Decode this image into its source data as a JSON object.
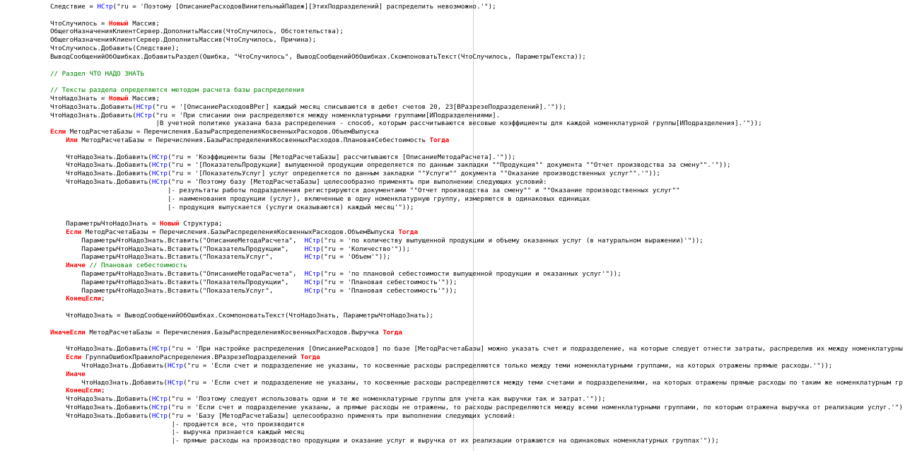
{
  "code": {
    "lines": [
      [
        {
          "t": "plain",
          "v": "Следствие = "
        },
        {
          "t": "fn",
          "v": "НСтр"
        },
        {
          "t": "plain",
          "v": "(\"ru = '"
        },
        {
          "t": "str",
          "v": "Поэтому [ОписаниеРасходовВинительныйПадеж][ЭтихПодразделений] распределить невозможно.'"
        },
        {
          "t": "plain",
          "v": "\");"
        }
      ],
      [],
      [
        {
          "t": "plain",
          "v": "ЧтоСлучилось = "
        },
        {
          "t": "kw",
          "v": "Новый"
        },
        {
          "t": "plain",
          "v": " Массив;"
        }
      ],
      [
        {
          "t": "plain",
          "v": "ОбщегоНазначенияКлиентСервер.ДополнитьМассив(ЧтоСлучилось, Обстоятельства);"
        }
      ],
      [
        {
          "t": "plain",
          "v": "ОбщегоНазначенияКлиентСервер.ДополнитьМассив(ЧтоСлучилось, Причина);"
        }
      ],
      [
        {
          "t": "plain",
          "v": "ЧтоСлучилось.Добавить(Следствие);"
        }
      ],
      [
        {
          "t": "plain",
          "v": "ВыводСообщенийОбОшибках.ДобавитьРаздел(Ошибка, "
        },
        {
          "t": "str",
          "v": "\"ЧтоСлучилось\""
        },
        {
          "t": "plain",
          "v": ", ВыводСообщенийОбОшибках.СкомпоноватьТекст(ЧтоСлучилось, ПараметрыТекста));"
        }
      ],
      [],
      [
        {
          "t": "cm",
          "v": "// Раздел ЧТО НАДО ЗНАТЬ"
        }
      ],
      [],
      [
        {
          "t": "cm",
          "v": "// Тексты раздела определяются методом расчета базы распределения"
        }
      ],
      [
        {
          "t": "plain",
          "v": "ЧтоНадоЗнать = "
        },
        {
          "t": "kw",
          "v": "Новый"
        },
        {
          "t": "plain",
          "v": " Массив;"
        }
      ],
      [
        {
          "t": "plain",
          "v": "ЧтоНадоЗнать.Добавить("
        },
        {
          "t": "fn",
          "v": "НСтр"
        },
        {
          "t": "plain",
          "v": "(\"ru = '"
        },
        {
          "t": "str",
          "v": "[ОписаниеРасходовВРег] каждый месяц списываются в дебет счетов 20, 23[ВРазрезеПодразделений]."
        },
        {
          "t": "plain",
          "v": "'\"));"
        }
      ],
      [
        {
          "t": "plain",
          "v": "ЧтоНадоЗнать.Добавить("
        },
        {
          "t": "fn",
          "v": "НСтр"
        },
        {
          "t": "plain",
          "v": "(\"ru = '"
        },
        {
          "t": "str",
          "v": "При списании они распределяются между номенклатурными группами[ИПодразделениями]."
        }
      ],
      [
        {
          "t": "plain",
          "v": "                           "
        },
        {
          "t": "str",
          "v": "|В учетной политике указана база распределения - способ, которым рассчитываются весовые коэффициенты для каждой номенклатурной группы[ИПодразделения]."
        },
        {
          "t": "plain",
          "v": "'\"));"
        }
      ],
      [
        {
          "t": "kw",
          "v": "Если"
        },
        {
          "t": "plain",
          "v": " МетодРасчетаБазы = Перечисления.БазыРаспределенияКосвенныхРасходов.ОбъемВыпуска"
        }
      ],
      [
        {
          "t": "plain",
          "v": "    "
        },
        {
          "t": "kw",
          "v": "Или"
        },
        {
          "t": "plain",
          "v": " МетодРасчетаБазы = Перечисления.БазыРаспределенияКосвенныхРасходов.ПлановаяСебестоимость "
        },
        {
          "t": "kw",
          "v": "Тогда"
        }
      ],
      [],
      [
        {
          "t": "plain",
          "v": "    ЧтоНадоЗнать.Добавить("
        },
        {
          "t": "fn",
          "v": "НСтр"
        },
        {
          "t": "plain",
          "v": "(\"ru = '"
        },
        {
          "t": "str",
          "v": "Коэффициенты базы [МетодРасчетаБазы] рассчитываются [ОписаниеМетодаРасчета]."
        },
        {
          "t": "plain",
          "v": "'\"));"
        }
      ],
      [
        {
          "t": "plain",
          "v": "    ЧтоНадоЗнать.Добавить("
        },
        {
          "t": "fn",
          "v": "НСтр"
        },
        {
          "t": "plain",
          "v": "(\"ru = '"
        },
        {
          "t": "str",
          "v": "[ПоказательПродукции] выпущенной продукции определяется по данным закладки \"\"Продукция\"\" документа \"\"Отчет производства за смену\"\"."
        },
        {
          "t": "plain",
          "v": "'\"));"
        }
      ],
      [
        {
          "t": "plain",
          "v": "    ЧтоНадоЗнать.Добавить("
        },
        {
          "t": "fn",
          "v": "НСтр"
        },
        {
          "t": "plain",
          "v": "(\"ru = '"
        },
        {
          "t": "str",
          "v": "[ПоказательУслуг] услуг определяется по данным закладки \"\"Услуги\"\" документа \"\"Оказание производственных услуг\"\"."
        },
        {
          "t": "plain",
          "v": "'\"));"
        }
      ],
      [
        {
          "t": "plain",
          "v": "    ЧтоНадоЗнать.Добавить("
        },
        {
          "t": "fn",
          "v": "НСтр"
        },
        {
          "t": "plain",
          "v": "(\"ru = '"
        },
        {
          "t": "str",
          "v": "Поэтому базу [МетодРасчетаБазы] целесообразно применять при выполнении следующих условий:"
        }
      ],
      [
        {
          "t": "plain",
          "v": "                              "
        },
        {
          "t": "str",
          "v": "|- результаты работы подразделения регистрируются документами \"\"Отчет производства за смену\"\" и \"\"Оказание производственных услуг\"\""
        }
      ],
      [
        {
          "t": "plain",
          "v": "                              "
        },
        {
          "t": "str",
          "v": "|- наименования продукции (услуг), включенные в одну номенклатурную группу, измеряются в одинаковых единицах"
        }
      ],
      [
        {
          "t": "plain",
          "v": "                              "
        },
        {
          "t": "str",
          "v": "|- продукция выпускается (услуги оказываются) каждый месяц"
        },
        {
          "t": "plain",
          "v": "'\"));"
        }
      ],
      [],
      [
        {
          "t": "plain",
          "v": "    ПараметрыЧтоНадоЗнать = "
        },
        {
          "t": "kw",
          "v": "Новый"
        },
        {
          "t": "plain",
          "v": " Структура;"
        }
      ],
      [
        {
          "t": "plain",
          "v": "    "
        },
        {
          "t": "kw",
          "v": "Если"
        },
        {
          "t": "plain",
          "v": " МетодРасчетаБазы = Перечисления.БазыРаспределенияКосвенныхРасходов.ОбъемВыпуска "
        },
        {
          "t": "kw",
          "v": "Тогда"
        }
      ],
      [
        {
          "t": "plain",
          "v": "        ПараметрыЧтоНадоЗнать.Вставить("
        },
        {
          "t": "str",
          "v": "\"ОписаниеМетодаРасчета\""
        },
        {
          "t": "plain",
          "v": ",  "
        },
        {
          "t": "fn",
          "v": "НСтр"
        },
        {
          "t": "plain",
          "v": "(\"ru = '"
        },
        {
          "t": "str",
          "v": "по количеству выпущенной продукции и объему оказанных услуг (в натуральном выражении)"
        },
        {
          "t": "plain",
          "v": "'\"));"
        }
      ],
      [
        {
          "t": "plain",
          "v": "        ПараметрыЧтоНадоЗнать.Вставить("
        },
        {
          "t": "str",
          "v": "\"ПоказательПродукции\""
        },
        {
          "t": "plain",
          "v": ",    "
        },
        {
          "t": "fn",
          "v": "НСтр"
        },
        {
          "t": "plain",
          "v": "(\"ru = '"
        },
        {
          "t": "str",
          "v": "Количество"
        },
        {
          "t": "plain",
          "v": "'\"));"
        }
      ],
      [
        {
          "t": "plain",
          "v": "        ПараметрыЧтоНадоЗнать.Вставить("
        },
        {
          "t": "str",
          "v": "\"ПоказательУслуг\""
        },
        {
          "t": "plain",
          "v": ",        "
        },
        {
          "t": "fn",
          "v": "НСтр"
        },
        {
          "t": "plain",
          "v": "(\"ru = '"
        },
        {
          "t": "str",
          "v": "Объем"
        },
        {
          "t": "plain",
          "v": "'\"));"
        }
      ],
      [
        {
          "t": "plain",
          "v": "    "
        },
        {
          "t": "kw",
          "v": "Иначе"
        },
        {
          "t": "plain",
          "v": " "
        },
        {
          "t": "cm",
          "v": "// Плановая себестоимость"
        }
      ],
      [
        {
          "t": "plain",
          "v": "        ПараметрыЧтоНадоЗнать.Вставить("
        },
        {
          "t": "str",
          "v": "\"ОписаниеМетодаРасчета\""
        },
        {
          "t": "plain",
          "v": ",  "
        },
        {
          "t": "fn",
          "v": "НСтр"
        },
        {
          "t": "plain",
          "v": "(\"ru = '"
        },
        {
          "t": "str",
          "v": "по плановой себестоимости выпущенной продукции и оказанных услуг"
        },
        {
          "t": "plain",
          "v": "'\"));"
        }
      ],
      [
        {
          "t": "plain",
          "v": "        ПараметрыЧтоНадоЗнать.Вставить("
        },
        {
          "t": "str",
          "v": "\"ПоказательПродукции\""
        },
        {
          "t": "plain",
          "v": ",    "
        },
        {
          "t": "fn",
          "v": "НСтр"
        },
        {
          "t": "plain",
          "v": "(\"ru = '"
        },
        {
          "t": "str",
          "v": "Плановая себестоимость"
        },
        {
          "t": "plain",
          "v": "'\"));"
        }
      ],
      [
        {
          "t": "plain",
          "v": "        ПараметрыЧтоНадоЗнать.Вставить("
        },
        {
          "t": "str",
          "v": "\"ПоказательУслуг\""
        },
        {
          "t": "plain",
          "v": ",        "
        },
        {
          "t": "fn",
          "v": "НСтр"
        },
        {
          "t": "plain",
          "v": "(\"ru = '"
        },
        {
          "t": "str",
          "v": "Плановая себестоимость"
        },
        {
          "t": "plain",
          "v": "'\"));"
        }
      ],
      [
        {
          "t": "plain",
          "v": "    "
        },
        {
          "t": "kw",
          "v": "КонецЕсли"
        },
        {
          "t": "plain",
          "v": ";"
        }
      ],
      [],
      [
        {
          "t": "plain",
          "v": "    ЧтоНадоЗнать = ВыводСообщенийОбОшибках.СкомпоноватьТекст(ЧтоНадоЗнать, ПараметрыЧтоНадоЗнать);"
        }
      ],
      [],
      [
        {
          "t": "kw",
          "v": "ИначеЕсли"
        },
        {
          "t": "plain",
          "v": " МетодРасчетаБазы = Перечисления.БазыРаспределенияКосвенныхРасходов.Выручка "
        },
        {
          "t": "kw",
          "v": "Тогда"
        }
      ],
      [],
      [
        {
          "t": "plain",
          "v": "    ЧтоНадоЗнать.Добавить("
        },
        {
          "t": "fn",
          "v": "НСтр"
        },
        {
          "t": "plain",
          "v": "(\"ru = '"
        },
        {
          "t": "str",
          "v": "При настройке распределения [ОписаниеРасходов] по базе [МетодРасчетаБазы] можно указать счет и подразделение, на которые следует отнести затраты, распределив их между номенклатурны"
        }
      ],
      [
        {
          "t": "plain",
          "v": "    "
        },
        {
          "t": "kw",
          "v": "Если"
        },
        {
          "t": "plain",
          "v": " ГруппаОшибокПравилоРаспределения.ВРазрезеПодразделений "
        },
        {
          "t": "kw",
          "v": "Тогда"
        }
      ],
      [
        {
          "t": "plain",
          "v": "        ЧтоНадоЗнать.Добавить("
        },
        {
          "t": "fn",
          "v": "НСтр"
        },
        {
          "t": "plain",
          "v": "(\"ru = '"
        },
        {
          "t": "str",
          "v": "Если счет и подразделение не указаны, то косвенные расходы распределяются только между теми номенклатурными группами, на которых отражены прямые расходы."
        },
        {
          "t": "plain",
          "v": "'\"));"
        }
      ],
      [
        {
          "t": "plain",
          "v": "    "
        },
        {
          "t": "kw",
          "v": "Иначе"
        }
      ],
      [
        {
          "t": "plain",
          "v": "        ЧтоНадоЗнать.Добавить("
        },
        {
          "t": "fn",
          "v": "НСтр"
        },
        {
          "t": "plain",
          "v": "(\"ru = '"
        },
        {
          "t": "str",
          "v": "Если счет и подразделение не указаны, то косвенные расходы распределяются между теми счетами и подразделениями, на которых отражены прямые расходы по таким же номенклатурным гр"
        }
      ],
      [
        {
          "t": "plain",
          "v": "    "
        },
        {
          "t": "kw",
          "v": "КонецЕсли"
        },
        {
          "t": "plain",
          "v": ";"
        }
      ],
      [
        {
          "t": "plain",
          "v": "    ЧтоНадоЗнать.Добавить("
        },
        {
          "t": "fn",
          "v": "НСтр"
        },
        {
          "t": "plain",
          "v": "(\"ru = '"
        },
        {
          "t": "str",
          "v": "Поэтому следует использовать одни и те же номенклатурные группы для учета как выручки так и затрат."
        },
        {
          "t": "plain",
          "v": "'\"));"
        }
      ],
      [
        {
          "t": "plain",
          "v": "    ЧтоНадоЗнать.Добавить("
        },
        {
          "t": "fn",
          "v": "НСтр"
        },
        {
          "t": "plain",
          "v": "(\"ru = '"
        },
        {
          "t": "str",
          "v": "Если счет и подразделение указаны, а прямые расходы не отражены, то расходы распределяются между всеми номенклатурными группами, по которым отражена выручка от реализации услуг."
        },
        {
          "t": "plain",
          "v": "'\")"
        }
      ],
      [
        {
          "t": "plain",
          "v": "    ЧтоНадоЗнать.Добавить("
        },
        {
          "t": "fn",
          "v": "НСтр"
        },
        {
          "t": "plain",
          "v": "(\"ru = '"
        },
        {
          "t": "str",
          "v": "Базу [МетодРасчетаБазы] целесообразно применять при выполнении следующих условий:"
        }
      ],
      [
        {
          "t": "plain",
          "v": "                               "
        },
        {
          "t": "str",
          "v": "|- продается все, что производится"
        }
      ],
      [
        {
          "t": "plain",
          "v": "                               "
        },
        {
          "t": "str",
          "v": "|- выручка признается каждый месяц"
        }
      ],
      [
        {
          "t": "plain",
          "v": "                               "
        },
        {
          "t": "str",
          "v": "|- прямые расходы на производство продукции и оказание услуг и выручка от их реализации отражаются на одинаковых номенклатурных группах"
        },
        {
          "t": "plain",
          "v": "'\"));"
        }
      ]
    ]
  }
}
